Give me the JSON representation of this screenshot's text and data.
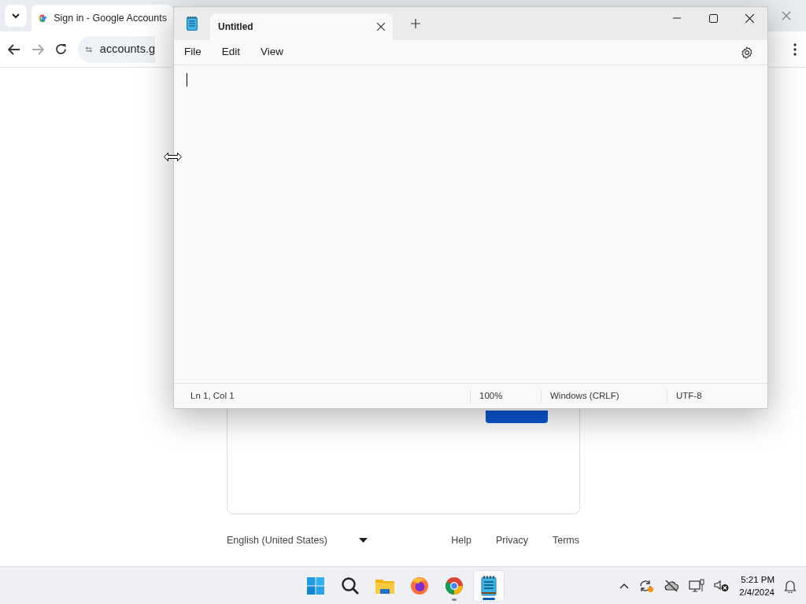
{
  "browser": {
    "tab": {
      "title": "Sign in - Google Accounts",
      "selected": true
    },
    "address": "accounts.g",
    "footer": {
      "language": "English (United States)",
      "links": [
        "Help",
        "Privacy",
        "Terms"
      ]
    }
  },
  "notepad": {
    "tab": {
      "title": "Untitled",
      "selected": true
    },
    "menu": [
      "File",
      "Edit",
      "View"
    ],
    "status": [
      "Ln 1, Col 1",
      "100%",
      "Windows (CRLF)",
      "UTF-8"
    ]
  },
  "taskbar": {
    "apps": [
      {
        "kind": "start",
        "running": false,
        "active": false
      },
      {
        "kind": "search",
        "running": false,
        "active": false
      },
      {
        "kind": "files",
        "running": false,
        "active": false
      },
      {
        "kind": "firefox",
        "running": false,
        "active": false
      },
      {
        "kind": "chrome",
        "running": true,
        "active": false
      },
      {
        "kind": "notepad",
        "running": true,
        "active": true
      }
    ],
    "clock": {
      "time": "5:21 PM",
      "date": "2/4/2024"
    }
  }
}
